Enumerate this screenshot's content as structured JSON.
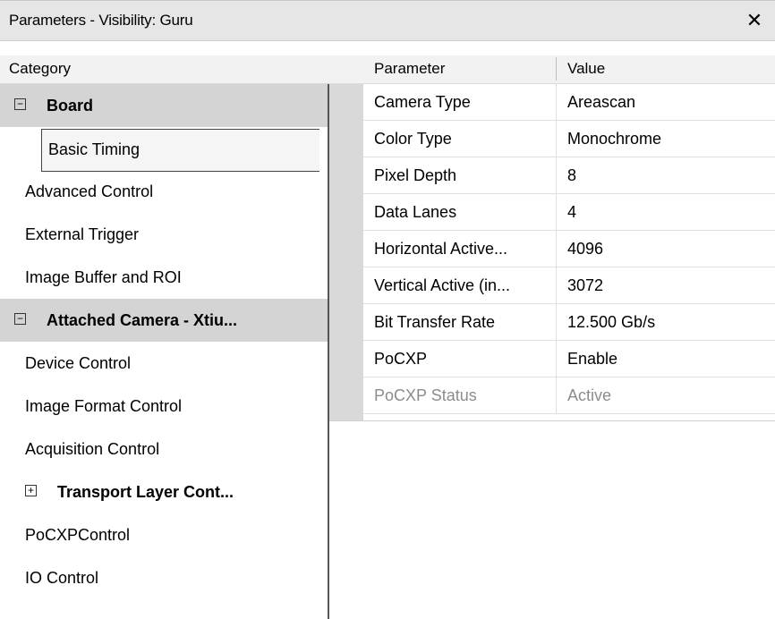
{
  "window": {
    "title": "Parameters - Visibility: Guru",
    "close_glyph": "✕"
  },
  "headers": {
    "category": "Category",
    "parameter": "Parameter",
    "value": "Value"
  },
  "categories": [
    {
      "label": "Board",
      "type": "group",
      "expanded": true,
      "toggle": "−"
    },
    {
      "label": "Basic Timing",
      "type": "child",
      "selected": true
    },
    {
      "label": "Advanced Control",
      "type": "child"
    },
    {
      "label": "External Trigger",
      "type": "child"
    },
    {
      "label": "Image Buffer and ROI",
      "type": "child"
    },
    {
      "label": "Attached Camera - Xtiu...",
      "type": "group",
      "expanded": true,
      "toggle": "−"
    },
    {
      "label": "Device Control",
      "type": "child"
    },
    {
      "label": "Image Format Control",
      "type": "child"
    },
    {
      "label": "Acquisition Control",
      "type": "child"
    },
    {
      "label": "Transport Layer Cont...",
      "type": "subgroup",
      "expanded": false,
      "toggle": "+"
    },
    {
      "label": "PoCXPControl",
      "type": "child"
    },
    {
      "label": "IO Control",
      "type": "child"
    }
  ],
  "parameters": [
    {
      "name": "Camera Type",
      "value": "Areascan"
    },
    {
      "name": "Color Type",
      "value": "Monochrome"
    },
    {
      "name": "Pixel Depth",
      "value": "8"
    },
    {
      "name": "Data Lanes",
      "value": "4"
    },
    {
      "name": "Horizontal Active...",
      "value": "4096"
    },
    {
      "name": "Vertical Active (in...",
      "value": "3072"
    },
    {
      "name": "Bit Transfer Rate",
      "value": "12.500 Gb/s"
    },
    {
      "name": "PoCXP",
      "value": "Enable"
    },
    {
      "name": "PoCXP Status",
      "value": "Active",
      "disabled": true
    }
  ],
  "colors": {
    "group_background": "#d4d4d4",
    "gutter": "#d9d9d9",
    "disabled_text": "#8c8c8c"
  }
}
